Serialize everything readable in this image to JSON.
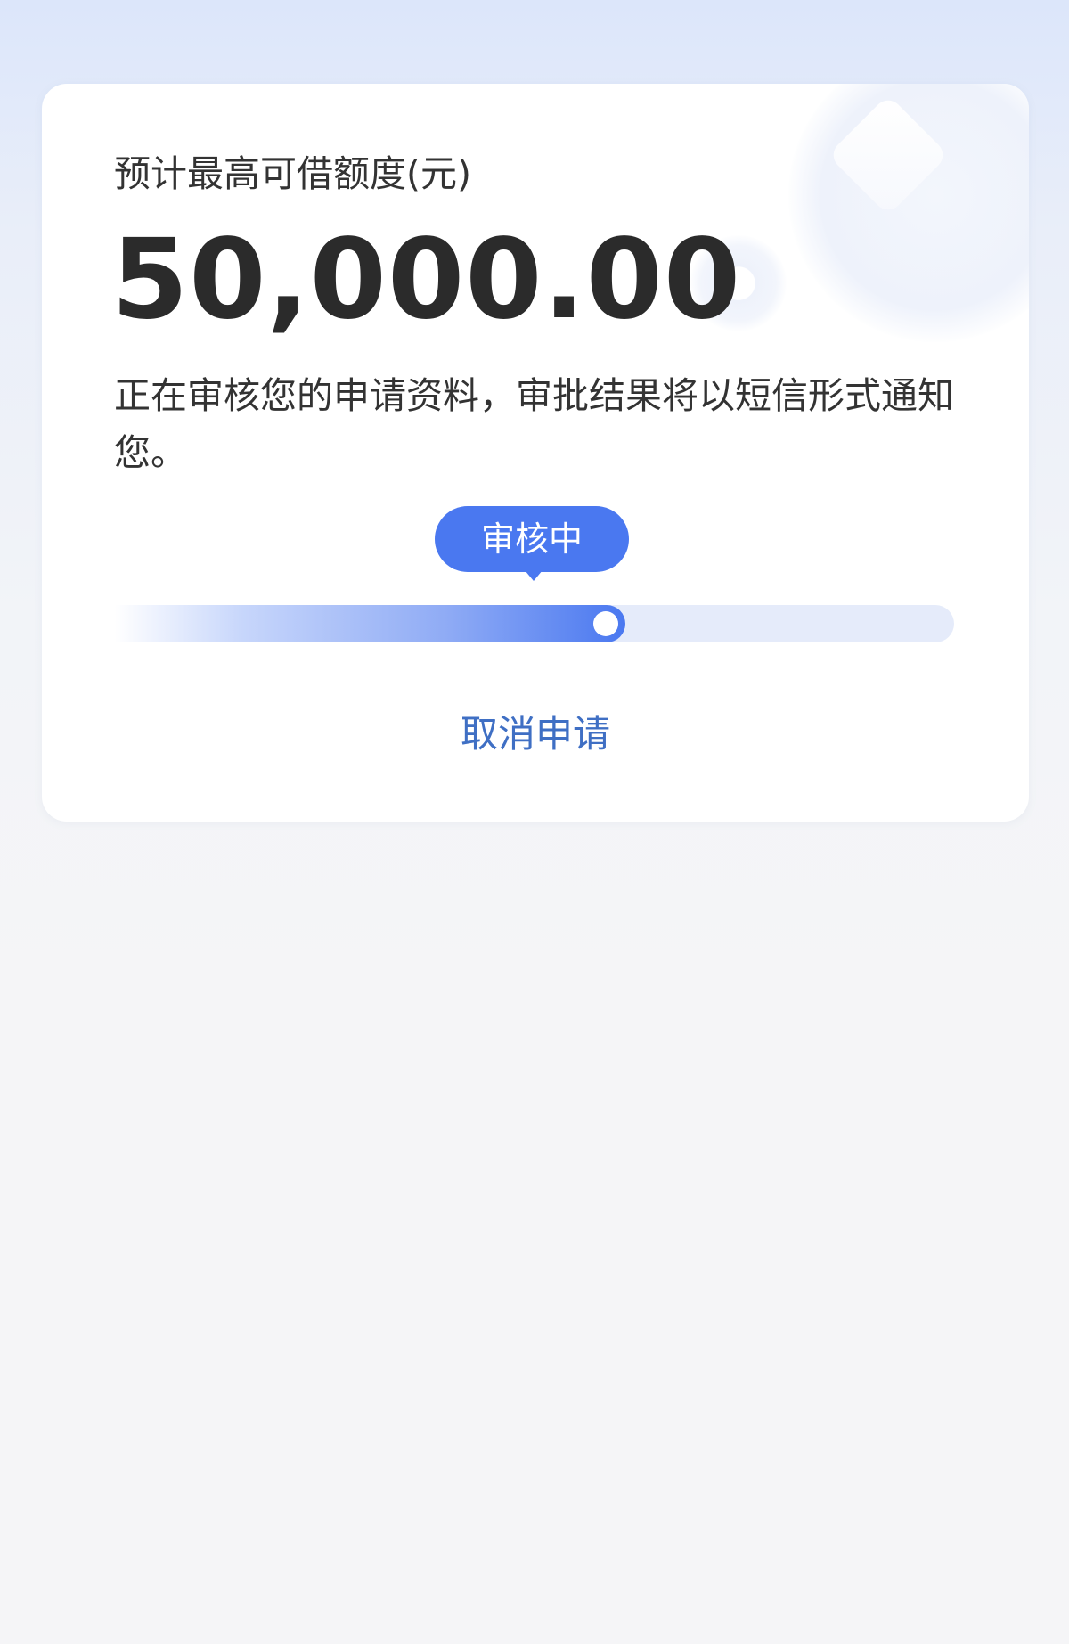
{
  "loan_card": {
    "limit_label": "预计最高可借额度(元)",
    "amount": "50,000.00",
    "review_message": "正在审核您的申请资料，审批结果将以短信形式通知您。",
    "status_tooltip": "审核中",
    "progress_percent": 60,
    "cancel_label": "取消申请"
  },
  "colors": {
    "accent": "#4a78f0",
    "link": "#3f6fc4",
    "text": "#333333",
    "track": "#e5ebfa"
  }
}
